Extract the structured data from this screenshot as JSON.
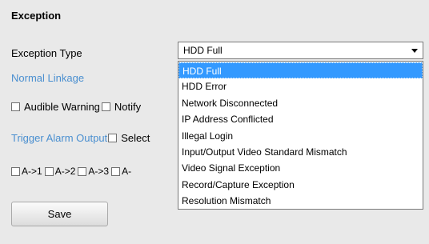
{
  "section": {
    "title": "Exception"
  },
  "exception_type": {
    "label": "Exception Type",
    "selected": "HDD Full",
    "options": [
      "HDD Full",
      "HDD Error",
      "Network Disconnected",
      "IP Address Conflicted",
      "Illegal Login",
      "Input/Output Video Standard Mismatch",
      "Video Signal Exception",
      "Record/Capture Exception",
      "Resolution Mismatch"
    ]
  },
  "normal_linkage": {
    "label": "Normal Linkage"
  },
  "linkage_options": {
    "audible_warning": "Audible Warning",
    "notify": "Notify"
  },
  "trigger_alarm_output": {
    "label": "Trigger Alarm Output",
    "select_all": "Select"
  },
  "alarm_outputs": [
    "A->1",
    "A->2",
    "A->3",
    "A-"
  ],
  "buttons": {
    "save": "Save"
  },
  "colors": {
    "link_blue": "#4a8fd0",
    "highlight": "#3399ff",
    "background": "#e9e9e9"
  }
}
